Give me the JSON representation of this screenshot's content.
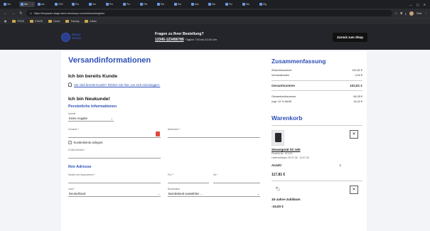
{
  "browser": {
    "tabs": [
      {
        "label": "Ver",
        "active": false
      },
      {
        "label": "Ver",
        "active": true
      },
      {
        "label": "sta",
        "active": false
      },
      {
        "label": "12% ",
        "active": false
      },
      {
        "label": "Pro",
        "active": false
      },
      {
        "label": "Ver",
        "active": false
      },
      {
        "label": "Pro",
        "active": false
      },
      {
        "label": "Pro",
        "active": false
      },
      {
        "label": "File",
        "active": false
      },
      {
        "label": "Sta",
        "active": false
      },
      {
        "label": "Ma",
        "active": false
      },
      {
        "label": "Abs",
        "active": false
      },
      {
        "label": "Sta",
        "active": false
      },
      {
        "label": "Pro",
        "active": false
      },
      {
        "label": "Sta",
        "active": false
      },
      {
        "label": "Dig",
        "active": false
      }
    ],
    "url": "https://shopware-stage.demo.sessioxyz.com/checkout/register",
    "profile_label": "Chat",
    "bookmarks": [
      "PROD",
      "STAGE",
      "Demo",
      "Training",
      "Admin"
    ]
  },
  "header": {
    "logo_line1": "Rasco",
    "logo_line2": "sessio",
    "help_title": "Fragen zu Ihrer Bestellung?",
    "help_phone": "12345-123456789",
    "help_hours": "Täglich 7:00 bis 22:00 Uhr",
    "back_button": "Zurück zum Shop"
  },
  "main": {
    "title": "Versandinformationen",
    "existing_customer_heading": "Ich bin bereits Kunde",
    "login_link": "Sie sind bereits Kunde? Klicken Sie hier, um sich einzuloggen.",
    "new_customer_heading": "Ich bin Neukunde!",
    "personal_heading": "Persönliche Informationen",
    "salutation_label": "Anrede",
    "salutation_value": "Keine Angabe",
    "firstname_label": "Vorname *",
    "lastname_label": "Nachname *",
    "create_account_label": "Kundenkonto anlegen.",
    "email_label": "E-Mail-Adresse *",
    "address_heading": "Ihre Adresse",
    "street_label": "Straße und Hausnummer *",
    "zip_label": "PLZ *",
    "city_label": "Ort *",
    "country_label": "Land *",
    "country_value": "Deutschland",
    "state_label": "Bundesland",
    "state_value": "Bundesland auswählen ..."
  },
  "summary": {
    "title": "Zusammenfassung",
    "subtotal_label": "Zwischensumme",
    "subtotal_value": "102,81 €",
    "shipping_label": "Versandkosten",
    "shipping_value": "0,00 €",
    "total_label": "Gesamtsumme",
    "total_value": "102,81 €",
    "net_label": "Gesamtnettosumme",
    "net_value": "86,39 €",
    "vat_label": "zzgl. 19 % MwSt.",
    "vat_value": "16,42 €"
  },
  "cart": {
    "title": "Warenkorb",
    "item_name": "Steuergerät SC-100",
    "item_sku": "Produkt-Nr.: SC100",
    "item_delivery": "Lieferzeitraum: 09.07.26 - 12.07.26",
    "qty_label": "Anzahl",
    "qty_value": "1",
    "item_price": "117,81 €",
    "promo_name": "15-Jahre-Jubiläum",
    "promo_price": "-15,00 €"
  }
}
